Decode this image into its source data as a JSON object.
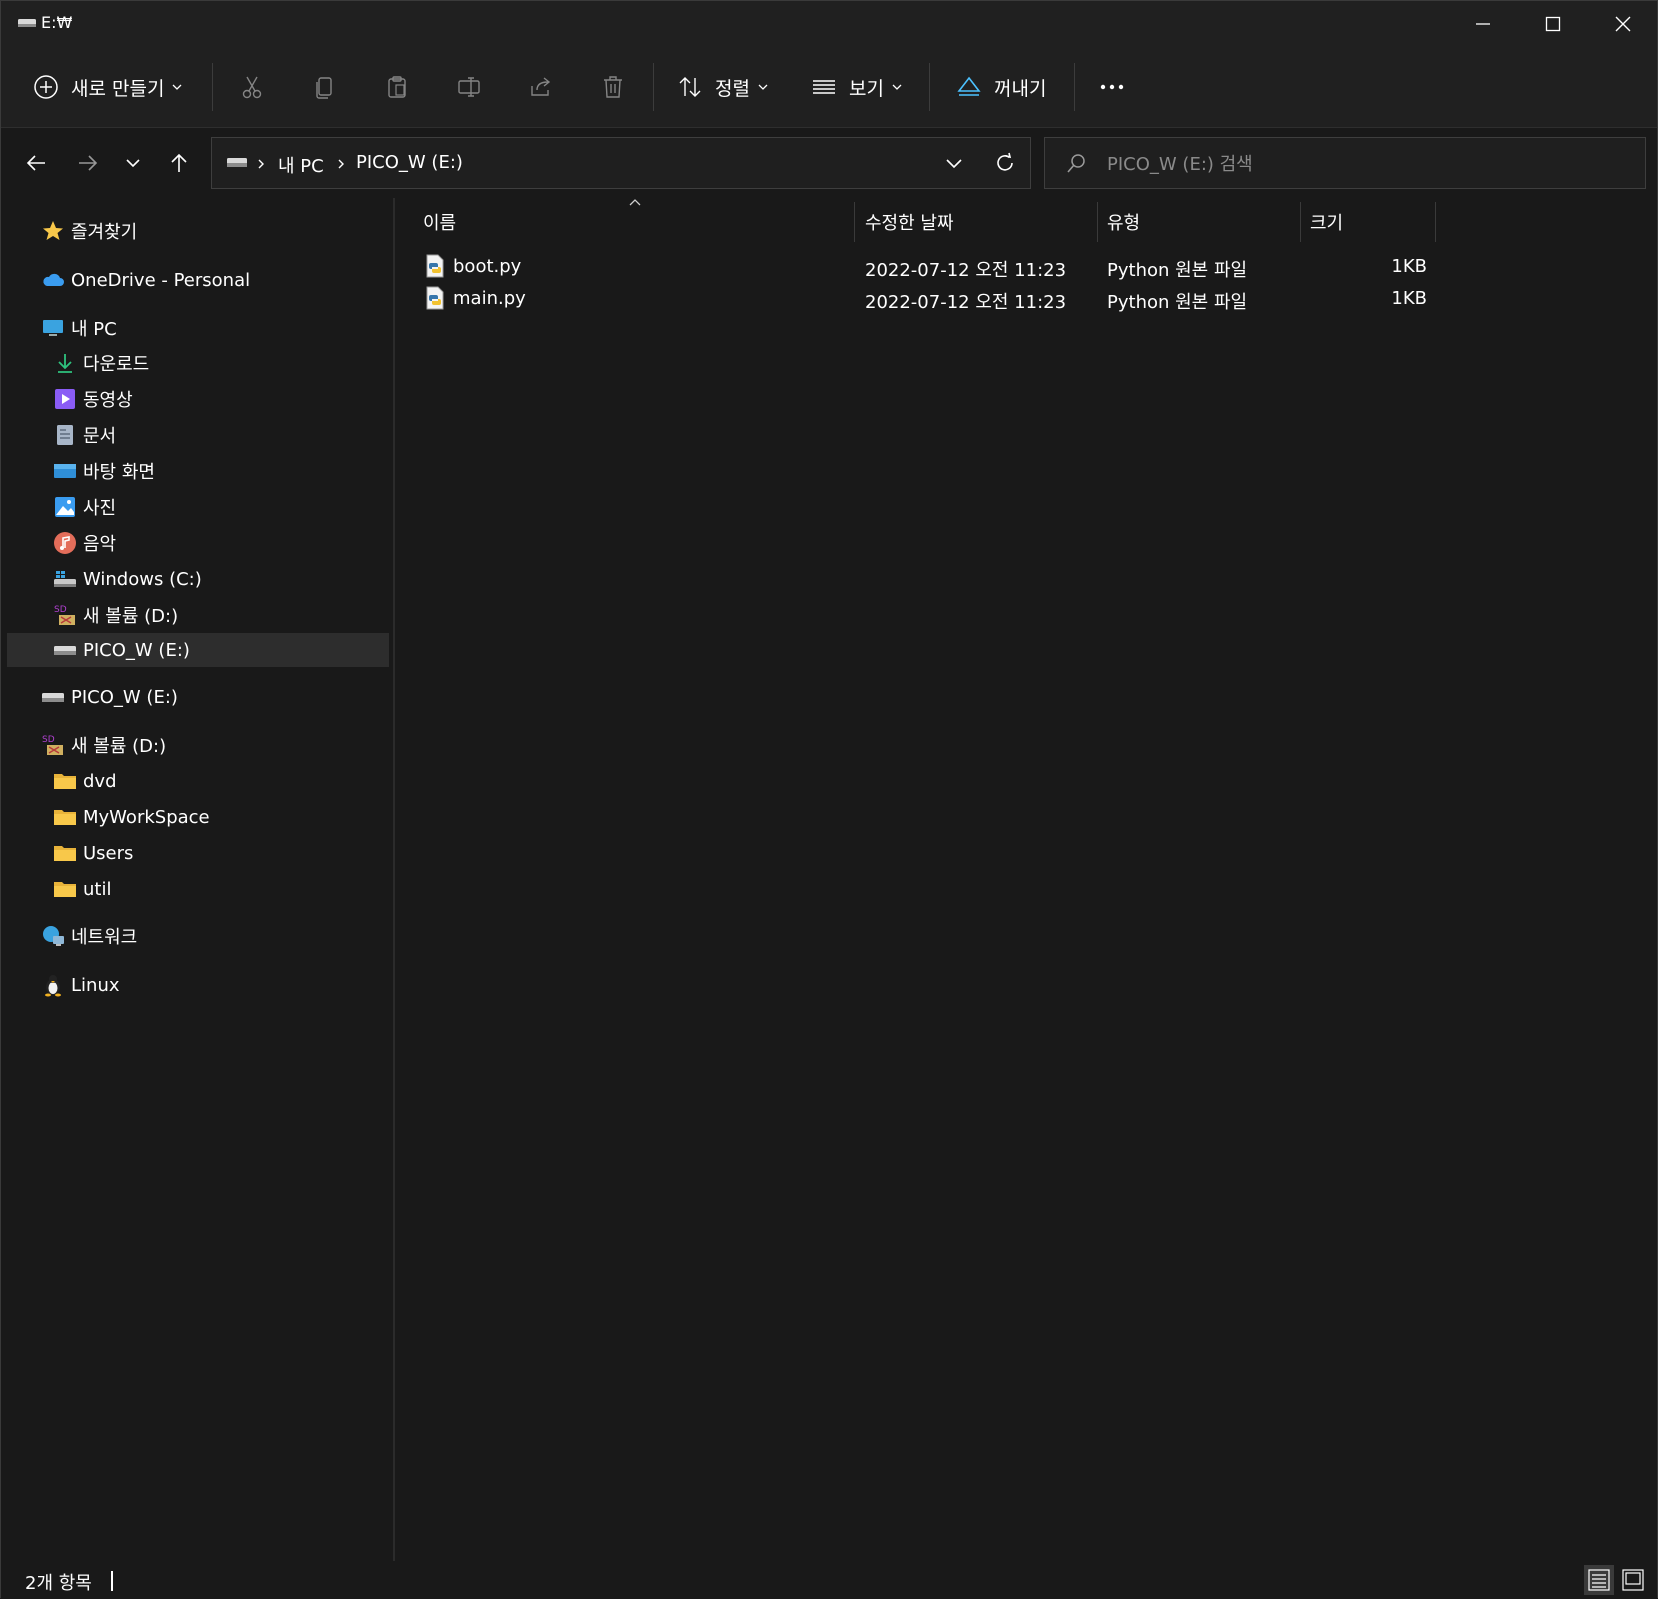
{
  "window": {
    "title": "E:₩"
  },
  "commandbar": {
    "new_label": "새로 만들기",
    "sort_label": "정렬",
    "view_label": "보기",
    "eject_label": "꺼내기"
  },
  "address": {
    "crumbs": [
      "내 PC",
      "PICO_W (E:)"
    ]
  },
  "search": {
    "placeholder": "PICO_W (E:) 검색"
  },
  "sidebar": {
    "items": [
      {
        "label": "즐겨찾기",
        "icon": "star-icon"
      },
      {
        "label": "OneDrive - Personal",
        "icon": "cloud-icon"
      },
      {
        "label": "내 PC",
        "icon": "computer-icon"
      },
      {
        "label": "다운로드",
        "icon": "download-icon"
      },
      {
        "label": "동영상",
        "icon": "video-icon"
      },
      {
        "label": "문서",
        "icon": "document-icon"
      },
      {
        "label": "바탕 화면",
        "icon": "desktop-icon"
      },
      {
        "label": "사진",
        "icon": "picture-icon"
      },
      {
        "label": "음악",
        "icon": "music-icon"
      },
      {
        "label": "Windows (C:)",
        "icon": "windows-drive-icon"
      },
      {
        "label": "새 볼륨 (D:)",
        "icon": "sd-drive-icon"
      },
      {
        "label": "PICO_W (E:)",
        "icon": "usb-drive-icon"
      },
      {
        "label": "PICO_W (E:)",
        "icon": "usb-drive-icon"
      },
      {
        "label": "새 볼륨 (D:)",
        "icon": "sd-drive-icon"
      },
      {
        "label": "dvd",
        "icon": "folder-icon"
      },
      {
        "label": "MyWorkSpace",
        "icon": "folder-icon"
      },
      {
        "label": "Users",
        "icon": "folder-icon"
      },
      {
        "label": "util",
        "icon": "folder-icon"
      },
      {
        "label": "네트워크",
        "icon": "network-icon"
      },
      {
        "label": "Linux",
        "icon": "linux-icon"
      }
    ]
  },
  "columns": {
    "name": "이름",
    "modified": "수정한 날짜",
    "type": "유형",
    "size": "크기"
  },
  "files": [
    {
      "name": "boot.py",
      "modified": "2022-07-12 오전 11:23",
      "type": "Python 원본 파일",
      "size": "1KB"
    },
    {
      "name": "main.py",
      "modified": "2022-07-12 오전 11:23",
      "type": "Python 원본 파일",
      "size": "1KB"
    }
  ],
  "status": {
    "item_count": "2개 항목"
  },
  "colors": {
    "background": "#191919",
    "chrome": "#202020",
    "selected": "#2d2d2d",
    "accent": "#4cc2ff",
    "folder": "#f8c84a"
  }
}
